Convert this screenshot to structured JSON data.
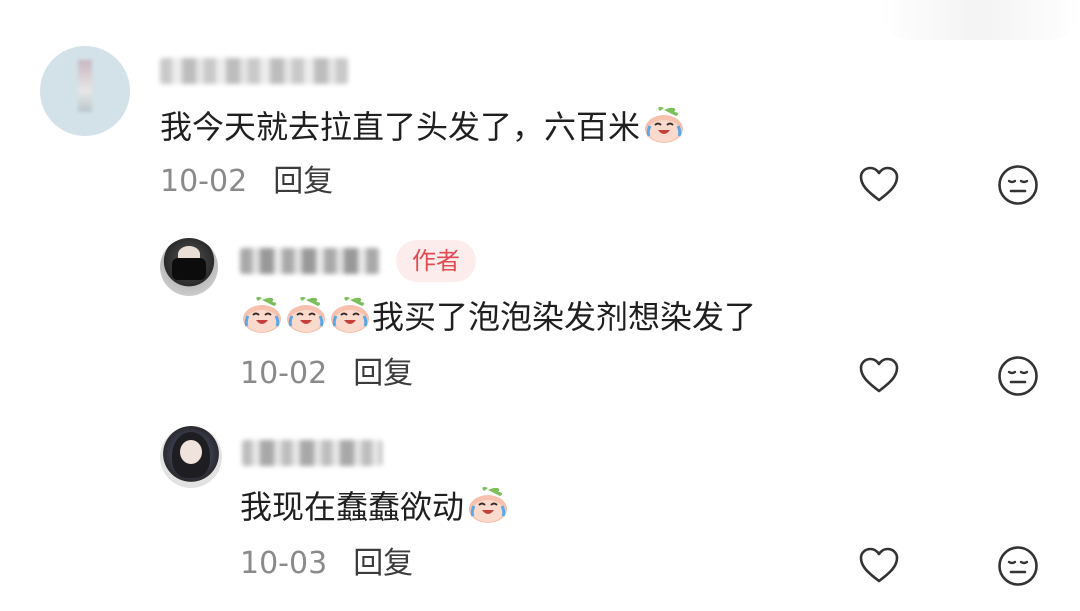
{
  "comments": [
    {
      "content": "我今天就去拉直了头发了，六百米",
      "date": "10-02",
      "reply_label": "回复"
    },
    {
      "author_badge": "作者",
      "content": "我买了泡泡染发剂想染发了",
      "date": "10-02",
      "reply_label": "回复"
    },
    {
      "content": "我现在蠢蠢欲动",
      "date": "10-03",
      "reply_label": "回复"
    }
  ],
  "icons": {
    "like": "heart-outline-icon",
    "dislike": "neutral-face-icon",
    "emoji": "crying-laughing-peach-emoji"
  },
  "colors": {
    "badge_text": "#e04b54",
    "badge_bg": "#fdecec",
    "meta_text": "#8a8a8a",
    "content_text": "#1f1f1f"
  }
}
